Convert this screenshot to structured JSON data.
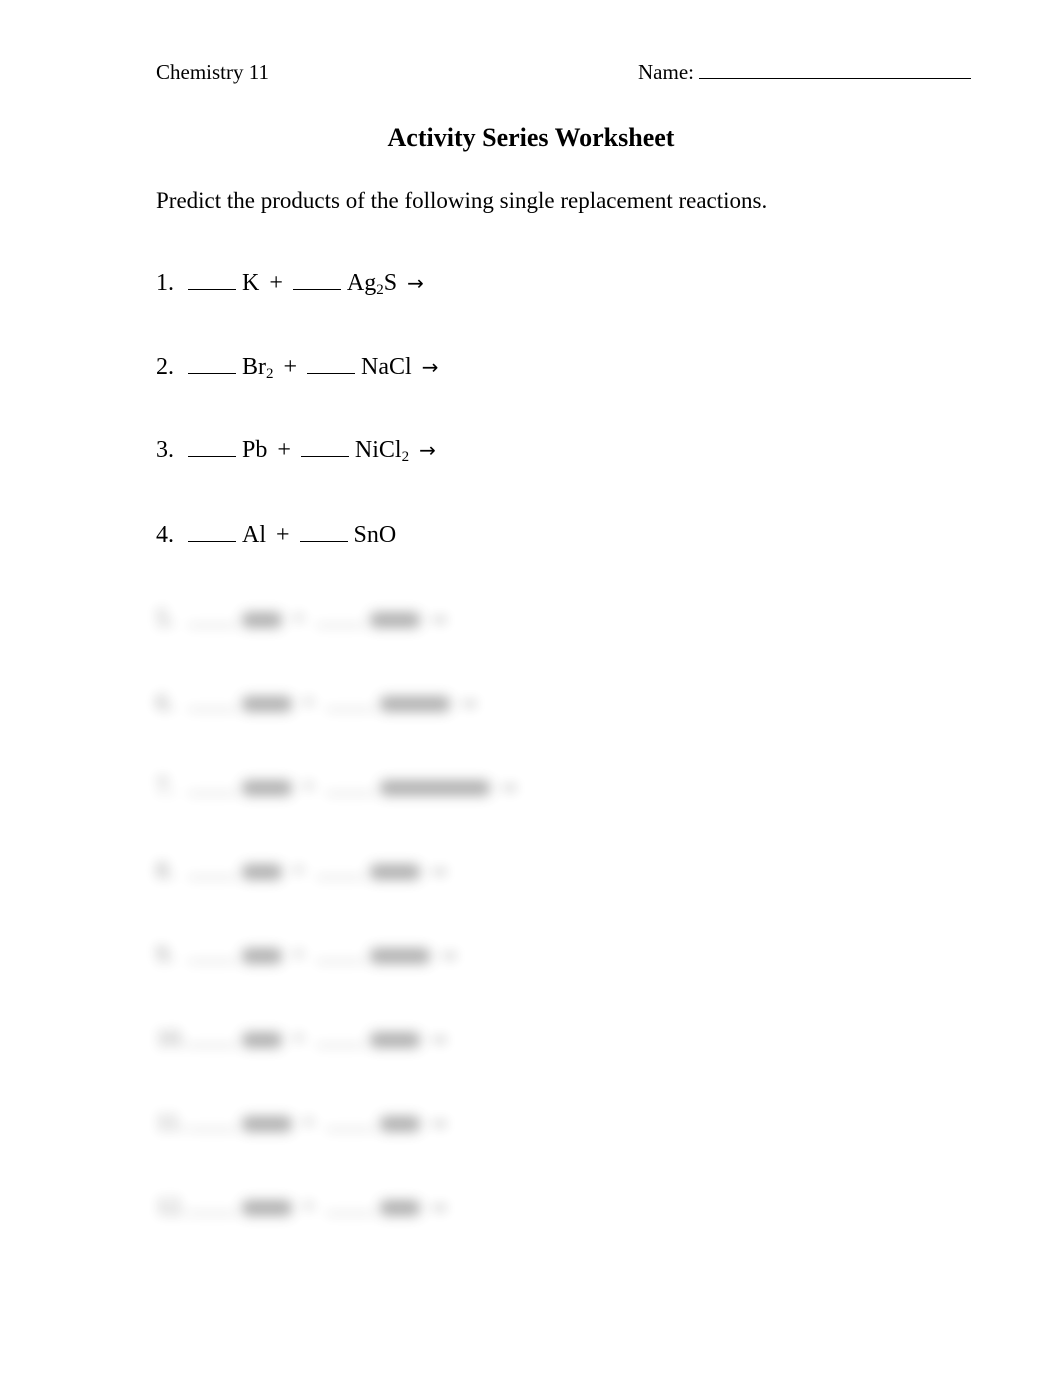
{
  "header": {
    "course": "Chemistry 11",
    "name_label": "Name:",
    "name_value": ""
  },
  "title": "Activity Series Worksheet",
  "instructions": "Predict the products of the following single replacement reactions.",
  "arrow_icon": "right-arrow",
  "questions": [
    {
      "num": "1.",
      "r1": "K",
      "r1_sub": "",
      "plus": "+",
      "r2": "Ag",
      "r2_sub": "2",
      "r2_tail": "S",
      "arrow": "→"
    },
    {
      "num": "2.",
      "r1": "Br",
      "r1_sub": "2",
      "plus": "+",
      "r2": "NaCl",
      "r2_sub": "",
      "r2_tail": "",
      "arrow": "→"
    },
    {
      "num": "3.",
      "r1": "Pb",
      "r1_sub": "",
      "plus": "+",
      "r2": "NiCl",
      "r2_sub": "2",
      "r2_tail": "",
      "arrow": "→"
    },
    {
      "num": "4.",
      "r1": "Al",
      "r1_sub": "",
      "plus": "+",
      "r2": "SnO",
      "r2_sub": "",
      "r2_tail": "",
      "arrow": ""
    }
  ],
  "blurred_questions": [
    "5.",
    "6.",
    "7.",
    "8.",
    "9.",
    "10.",
    "11.",
    "12."
  ]
}
